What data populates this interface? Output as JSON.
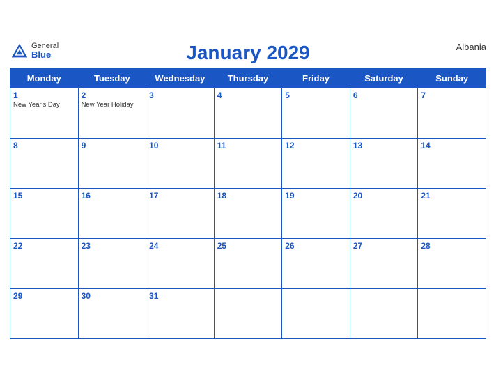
{
  "header": {
    "title": "January 2029",
    "country": "Albania",
    "logo_general": "General",
    "logo_blue": "Blue"
  },
  "weekdays": [
    "Monday",
    "Tuesday",
    "Wednesday",
    "Thursday",
    "Friday",
    "Saturday",
    "Sunday"
  ],
  "weeks": [
    [
      {
        "day": "1",
        "events": [
          "New Year's Day"
        ]
      },
      {
        "day": "2",
        "events": [
          "New Year Holiday"
        ]
      },
      {
        "day": "3",
        "events": []
      },
      {
        "day": "4",
        "events": []
      },
      {
        "day": "5",
        "events": []
      },
      {
        "day": "6",
        "events": []
      },
      {
        "day": "7",
        "events": []
      }
    ],
    [
      {
        "day": "8",
        "events": []
      },
      {
        "day": "9",
        "events": []
      },
      {
        "day": "10",
        "events": []
      },
      {
        "day": "11",
        "events": []
      },
      {
        "day": "12",
        "events": []
      },
      {
        "day": "13",
        "events": []
      },
      {
        "day": "14",
        "events": []
      }
    ],
    [
      {
        "day": "15",
        "events": []
      },
      {
        "day": "16",
        "events": []
      },
      {
        "day": "17",
        "events": []
      },
      {
        "day": "18",
        "events": []
      },
      {
        "day": "19",
        "events": []
      },
      {
        "day": "20",
        "events": []
      },
      {
        "day": "21",
        "events": []
      }
    ],
    [
      {
        "day": "22",
        "events": []
      },
      {
        "day": "23",
        "events": []
      },
      {
        "day": "24",
        "events": []
      },
      {
        "day": "25",
        "events": []
      },
      {
        "day": "26",
        "events": []
      },
      {
        "day": "27",
        "events": []
      },
      {
        "day": "28",
        "events": []
      }
    ],
    [
      {
        "day": "29",
        "events": []
      },
      {
        "day": "30",
        "events": []
      },
      {
        "day": "31",
        "events": []
      },
      {
        "day": "",
        "events": []
      },
      {
        "day": "",
        "events": []
      },
      {
        "day": "",
        "events": []
      },
      {
        "day": "",
        "events": []
      }
    ]
  ]
}
